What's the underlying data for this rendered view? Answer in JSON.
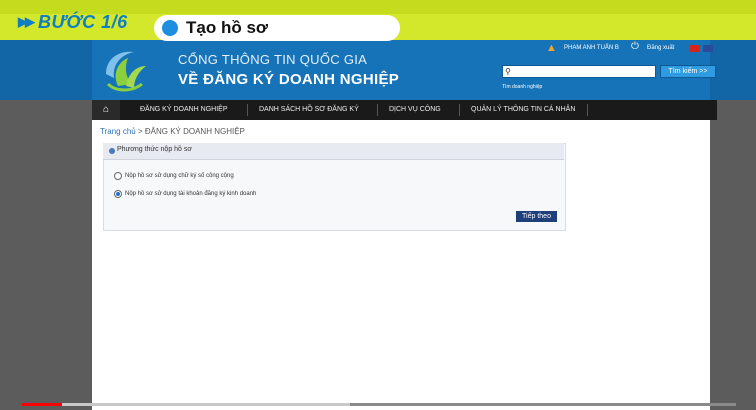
{
  "overlay": {
    "step_label": "BƯỚC 1/6",
    "step_title": "Tạo hồ sơ"
  },
  "header": {
    "portal_line1": "CỔNG THÔNG TIN QUỐC GIA",
    "portal_line2": "VỀ ĐĂNG KÝ DOANH NGHIỆP",
    "user_name": "PHAM ANH TUẤN B",
    "logout_label": "Đăng xuất",
    "search_placeholder": "",
    "search_button": "Tìm kiếm >>",
    "search_sub": "Tìm doanh nghiệp"
  },
  "nav": {
    "items": [
      {
        "label": "ĐĂNG KÝ DOANH NGHIỆP"
      },
      {
        "label": "DANH SÁCH HỒ SƠ ĐĂNG KÝ"
      },
      {
        "label": "DỊCH VỤ CÔNG"
      },
      {
        "label": "QUẢN LÝ THÔNG TIN CÁ NHÂN"
      }
    ]
  },
  "breadcrumb": {
    "home": "Trang chủ",
    "separator": " > ",
    "current": "ĐĂNG KÝ DOANH NGHIỆP"
  },
  "panel": {
    "title": "Phương thức nộp hồ sơ",
    "options": [
      {
        "label": "Nộp hồ sơ sử dụng chữ ký số công cộng",
        "selected": false
      },
      {
        "label": "Nộp hồ sơ sử dụng tài khoản đăng ký kinh doanh",
        "selected": true
      }
    ],
    "next_button": "Tiếp theo"
  },
  "video": {
    "played_fraction": 0.056,
    "buffered_fraction": 0.46
  },
  "colors": {
    "banner": "#d4e82b",
    "header_blue": "#1773b8",
    "nav_dark": "#1a1a1a",
    "button_navy": "#1e3f7a",
    "progress_red": "#ff0000"
  }
}
